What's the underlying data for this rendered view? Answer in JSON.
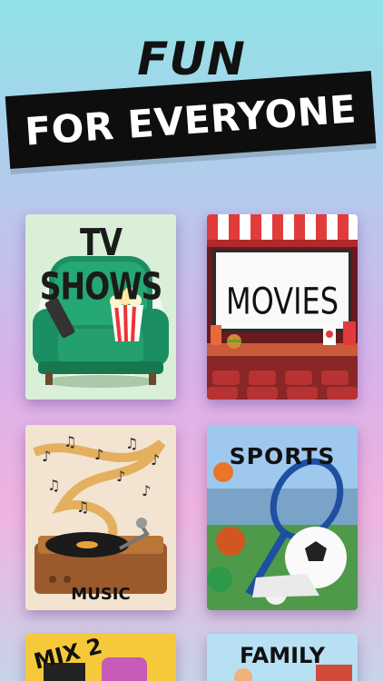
{
  "header": {
    "line1": "FUN",
    "line2": "FOR EVERYONE"
  },
  "categories": [
    {
      "label": "TV SHOWS"
    },
    {
      "label": "MOVIES"
    },
    {
      "label": "MUSIC"
    },
    {
      "label": "SPORTS"
    },
    {
      "label": "MIX 2"
    },
    {
      "label": "FAMILY"
    }
  ],
  "colors": {
    "banner": "#0e0e0e",
    "armchair": "#1f9a6b",
    "curtain_red": "#e03c3c"
  }
}
